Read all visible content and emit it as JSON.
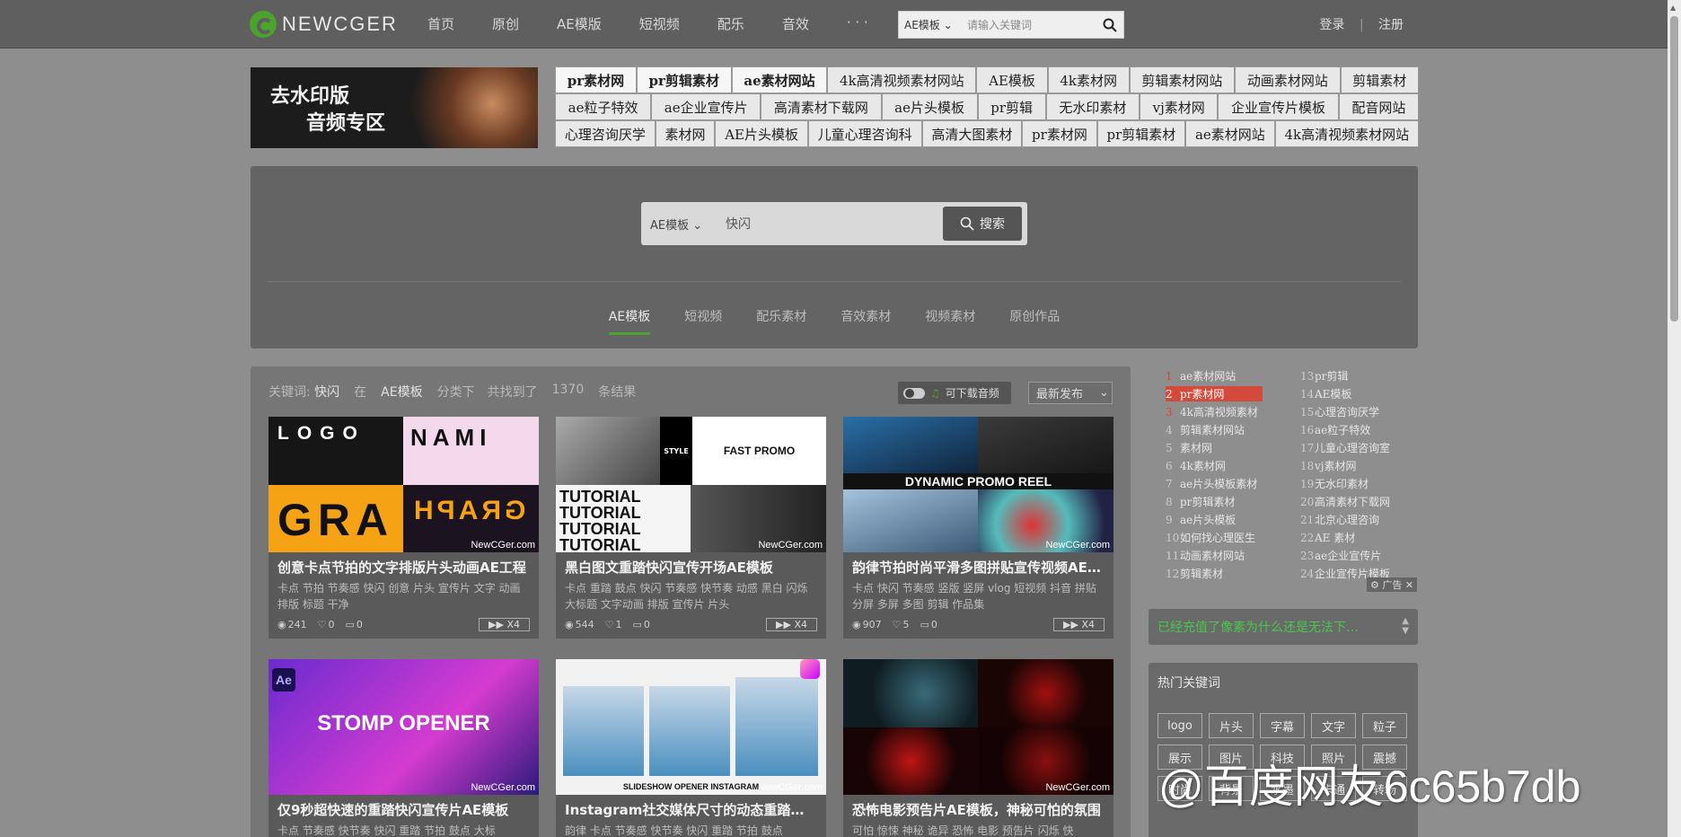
{
  "topbar": {
    "logo_text": "NEWCGER",
    "nav": [
      "首页",
      "原创",
      "AE模版",
      "短视频",
      "配乐",
      "音效",
      "· · ·"
    ],
    "search_select": "AE模板",
    "search_placeholder": "请输入关键词",
    "login": "登录",
    "register": "注册"
  },
  "banner": {
    "line1": "去水印版",
    "line2": "音频专区"
  },
  "tag_rows": [
    [
      "pr素材网",
      "pr剪辑素材",
      "ae素材网站",
      "4k高清视频素材网站",
      "AE模板",
      "4k素材网",
      "剪辑素材网站",
      "动画素材网站",
      "剪辑素材"
    ],
    [
      "ae粒子特效",
      "ae企业宣传片",
      "高清素材下载网",
      "ae片头模板",
      "pr剪辑",
      "无水印素材",
      "vj素材网",
      "企业宣传片模板",
      "配音网站"
    ],
    [
      "心理咨询厌学",
      "素材网",
      "AE片头模板",
      "儿童心理咨询科",
      "高清大图素材",
      "pr素材网",
      "pr剪辑素材",
      "ae素材网站",
      "4k高清视频素材网站"
    ]
  ],
  "main_search": {
    "category": "AE模板",
    "query": "快闪",
    "button": "搜索"
  },
  "categories": [
    "AE模板",
    "短视频",
    "配乐素材",
    "音效素材",
    "视频素材",
    "原创作品"
  ],
  "results_header": {
    "label": "关键词:",
    "keyword": "快闪",
    "in": "在",
    "category": "AE模板",
    "mid": "分类下　共找到了",
    "count": "1370",
    "tail": "条结果",
    "audio_toggle": "可下载音频",
    "sort": "最新发布"
  },
  "watermark": "NewCGer.com",
  "cards": [
    {
      "title": "创意卡点节拍的文字排版片头动画AE工程",
      "keywords": "卡点 节拍 节奏感 快闪 创意 片头 宣传片 文字 动画 排版 标题 干净",
      "views": "241",
      "likes": "0",
      "comments": "0",
      "badge": "X4",
      "thumb_text": "LOGO"
    },
    {
      "title": "黑白图文重踏快闪宣传开场AE模板",
      "keywords": "卡点 重踏 鼓点 快闪 节奏感 快节奏 动感 黑白 闪烁 大标题 文字动画 排版 宣传片 片头",
      "views": "544",
      "likes": "1",
      "comments": "0",
      "badge": "X4",
      "thumb_text": "FAST PROMO"
    },
    {
      "title": "韵律节拍时尚平滑多图拼贴宣传视频AE…",
      "keywords": "卡点 快闪 节奏感 竖版 竖屏 vlog 短视频 抖音 拼贴 分屏 多屏 多图 剪辑 作品集",
      "views": "907",
      "likes": "5",
      "comments": "0",
      "badge": "X4",
      "thumb_text": "DYNAMIC PROMO REEL"
    },
    {
      "title": "仅9秒超快速的重踏快闪宣传片AE模板",
      "keywords": "卡点 节奏感 快节奏 快闪 重踏 节拍 鼓点 大标",
      "thumb_text": "STOMP OPENER"
    },
    {
      "title": "Instagram社交媒体尺寸的动态重踏片…",
      "keywords": "韵律 卡点 节奏感 快节奏 快闪 重踏 节拍 鼓点",
      "thumb_text": "SLIDESHOW OPENER INSTAGRAM"
    },
    {
      "title": "恐怖电影预告片AE模板，神秘可怕的氛围",
      "keywords": "可怕 惊悚 神秘 诡异 恐怖 电影 预告片 闪烁 快",
      "thumb_text": ""
    }
  ],
  "hot_list": [
    {
      "n": "1",
      "t": "ae素材网站"
    },
    {
      "n": "2",
      "t": "pr素材网"
    },
    {
      "n": "3",
      "t": "4k高清视频素材"
    },
    {
      "n": "4",
      "t": "剪辑素材网站"
    },
    {
      "n": "5",
      "t": "素材网"
    },
    {
      "n": "6",
      "t": "4k素材网"
    },
    {
      "n": "7",
      "t": "ae片头模板素材"
    },
    {
      "n": "8",
      "t": "pr剪辑素材"
    },
    {
      "n": "9",
      "t": "ae片头模板"
    },
    {
      "n": "10",
      "t": "如何找心理医生"
    },
    {
      "n": "11",
      "t": "动画素材网站"
    },
    {
      "n": "12",
      "t": "剪辑素材"
    },
    {
      "n": "13",
      "t": "pr剪辑"
    },
    {
      "n": "14",
      "t": "AE模板"
    },
    {
      "n": "15",
      "t": "心理咨询厌学"
    },
    {
      "n": "16",
      "t": "ae粒子特效"
    },
    {
      "n": "17",
      "t": "儿童心理咨询室"
    },
    {
      "n": "18",
      "t": "vj素材网"
    },
    {
      "n": "19",
      "t": "无水印素材"
    },
    {
      "n": "20",
      "t": "高清素材下载网"
    },
    {
      "n": "21",
      "t": "北京心理咨询"
    },
    {
      "n": "22",
      "t": "AE 素材"
    },
    {
      "n": "23",
      "t": "ae企业宣传片"
    },
    {
      "n": "24",
      "t": "企业宣传片模板"
    }
  ],
  "ad_label": "广告",
  "notice": "已经充值了像素为什么还是无法下…",
  "hot_keywords": {
    "title": "热门关键词",
    "items": [
      "logo",
      "片头",
      "字幕",
      "文字",
      "粒子",
      "展示",
      "图片",
      "科技",
      "照片",
      "震撼",
      "时尚",
      "背景",
      "水墨",
      "卡通",
      "转场"
    ]
  },
  "overlay_text": "@百度网友6c65b7db",
  "colors": {
    "accent": "#4aa32a",
    "rank_red": "#d44a3a",
    "notice_green": "#49c74a"
  }
}
